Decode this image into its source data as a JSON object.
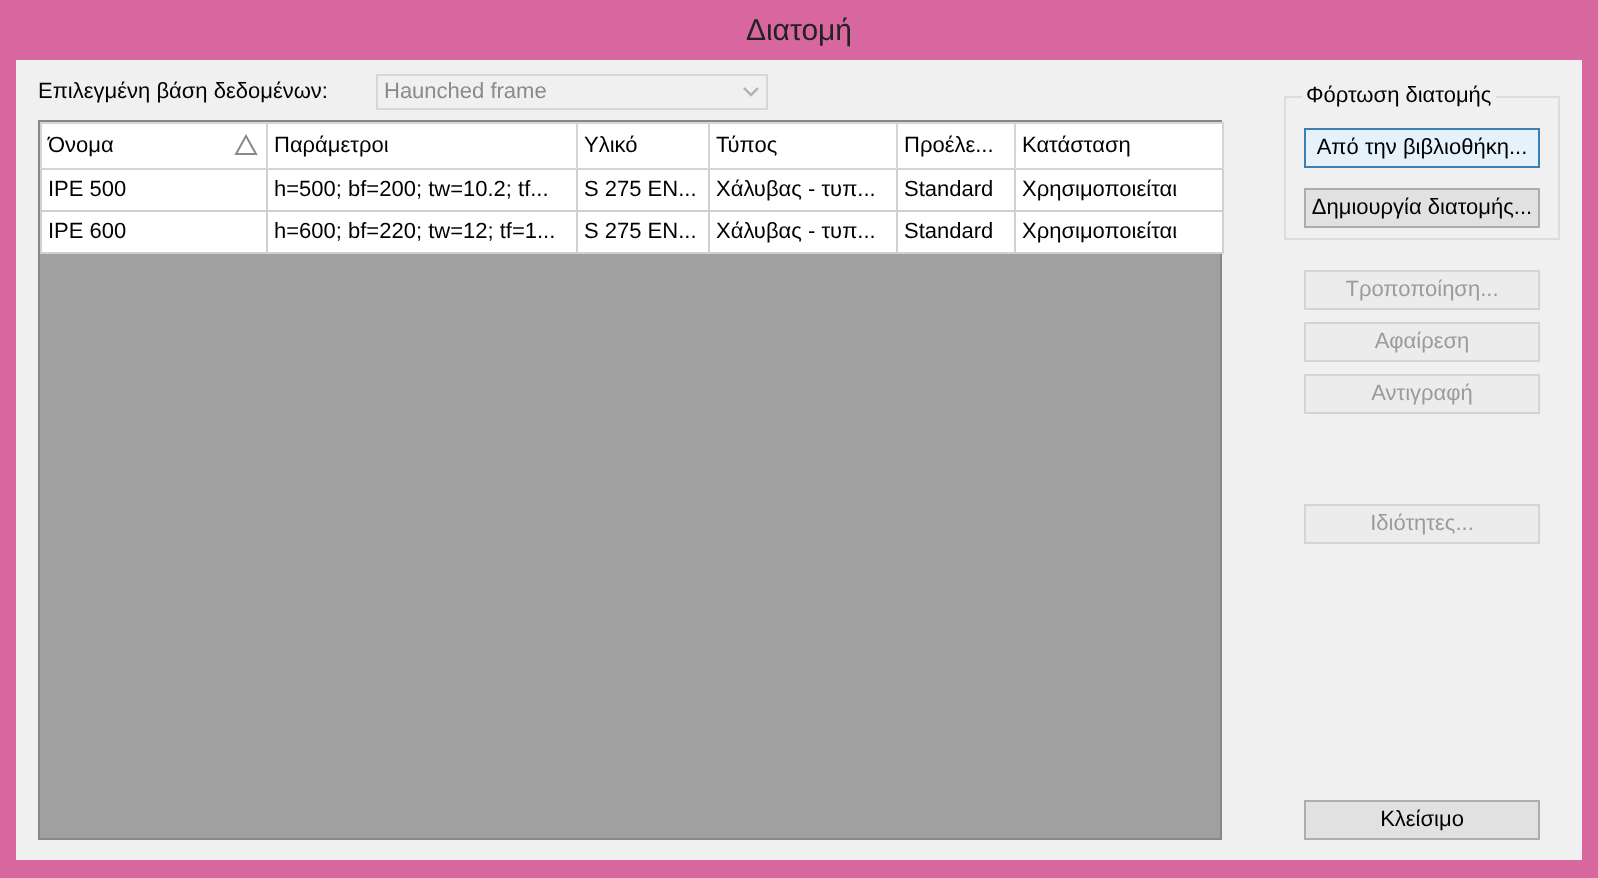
{
  "window": {
    "title": "Διατομή"
  },
  "database": {
    "label": "Επιλεγμένη βάση δεδομένων:",
    "value": "Haunched frame",
    "disabled": true
  },
  "table": {
    "columns": [
      {
        "label": "Όνομα",
        "sorted": true
      },
      {
        "label": "Παράμετροι",
        "sorted": false
      },
      {
        "label": "Υλικό",
        "sorted": false
      },
      {
        "label": "Τύπος",
        "sorted": false
      },
      {
        "label": "Προέλε...",
        "sorted": false
      },
      {
        "label": "Κατάσταση",
        "sorted": false
      }
    ],
    "rows": [
      [
        "IPE 500",
        "h=500; bf=200; tw=10.2; tf...",
        "S 275 EN...",
        "Χάλυβας - τυπ...",
        "Standard",
        "Χρησιμοποιείται"
      ],
      [
        "IPE 600",
        "h=600; bf=220; tw=12; tf=1...",
        "S 275 EN...",
        "Χάλυβας - τυπ...",
        "Standard",
        "Χρησιμοποιείται"
      ]
    ]
  },
  "load_group": {
    "title": "Φόρτωση διατομής",
    "buttons": [
      {
        "label": "Από την βιβλιοθήκη...",
        "disabled": false,
        "focused": true
      },
      {
        "label": "Δημιουργία διατομής...",
        "disabled": false,
        "focused": false
      }
    ]
  },
  "actions": [
    {
      "label": "Τροποποίηση...",
      "disabled": true
    },
    {
      "label": "Αφαίρεση",
      "disabled": true
    },
    {
      "label": "Αντιγραφή",
      "disabled": true
    },
    {
      "label": "Ιδιότητες...",
      "disabled": true
    }
  ],
  "close_button": {
    "label": "Κλείσιμο"
  }
}
